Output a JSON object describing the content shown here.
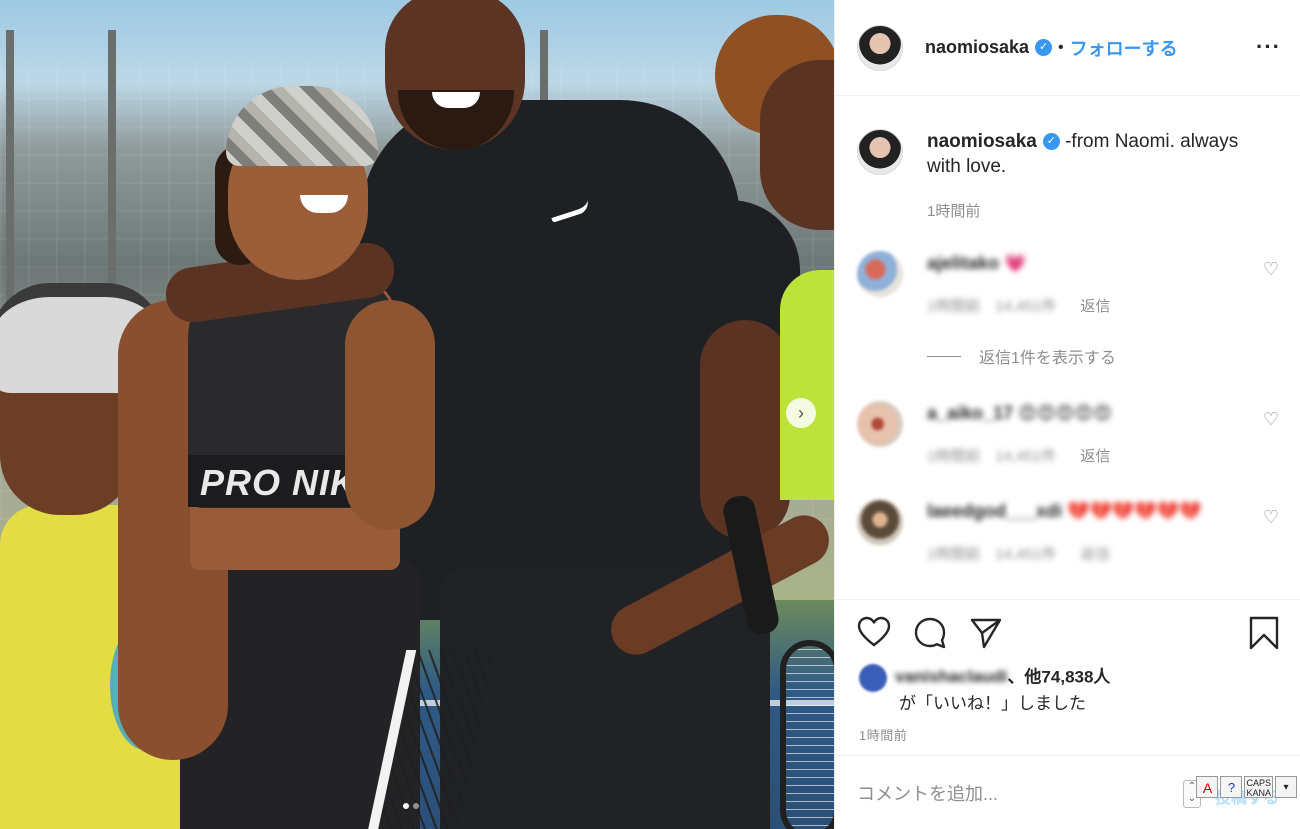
{
  "post": {
    "photo_overlay_text": "PRO NIKE",
    "carousel_dots": 2,
    "carousel_active": 0
  },
  "header": {
    "username": "naomiosaka",
    "separator": "•",
    "follow_label": "フォローする",
    "more_label": "···"
  },
  "caption": {
    "username": "naomiosaka",
    "text": " -from Naomi. always with love.",
    "time": "1時間前"
  },
  "comments": [
    {
      "username": "ajelitako 💗",
      "meta": "1時間前　14,451件",
      "reply_label": "返信",
      "avatar_color": "#c7a59a"
    },
    {
      "username": "a_aiko_17 😍😍😍😍😍",
      "meta": "1時間前　14,451件",
      "reply_label": "返信",
      "avatar_color": "#c98b7b"
    },
    {
      "username": "laeedgod___xdi 💔💔💔💔💔💔",
      "meta": "1時間前　14,451件",
      "reply_label": "返信",
      "avatar_color": "#7c6a58"
    }
  ],
  "view_replies_label": "返信1件を表示する",
  "likes": {
    "liker": "vanishaclaudi",
    "count_text": "、他74,838人",
    "suffix": "が「いいね！」しました"
  },
  "post_time": "1時間前",
  "comment_input": {
    "placeholder": "コメントを追加...",
    "post_label": "投稿する"
  },
  "ime": {
    "caps_label": "CAPS",
    "kana_label": "KANA"
  },
  "colors": {
    "accent": "#3897f0",
    "muted": "#8e8e8e",
    "text": "#262626"
  }
}
